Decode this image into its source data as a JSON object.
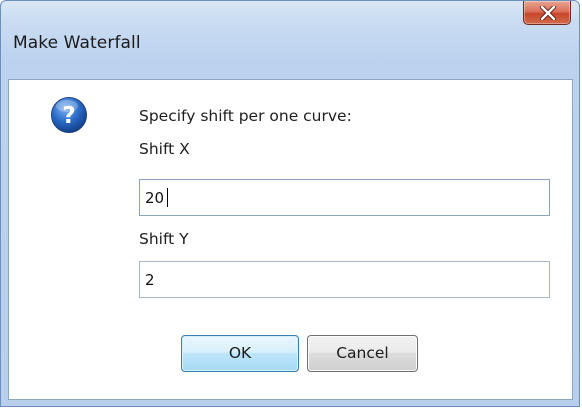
{
  "window": {
    "title": "Make Waterfall"
  },
  "dialog": {
    "prompt": "Specify shift per one curve:",
    "shift_x_label": "Shift X",
    "shift_x_value": "20",
    "shift_y_label": "Shift Y",
    "shift_y_value": "2"
  },
  "buttons": {
    "ok_label": "OK",
    "cancel_label": "Cancel"
  },
  "icons": {
    "dialog_icon": "question-icon",
    "close": "close-icon"
  },
  "colors": {
    "title_bar": "#c9dcf2",
    "close_button": "#c7462a",
    "question_icon": "#1f5fb8",
    "ok_button": "#bee6fd"
  }
}
